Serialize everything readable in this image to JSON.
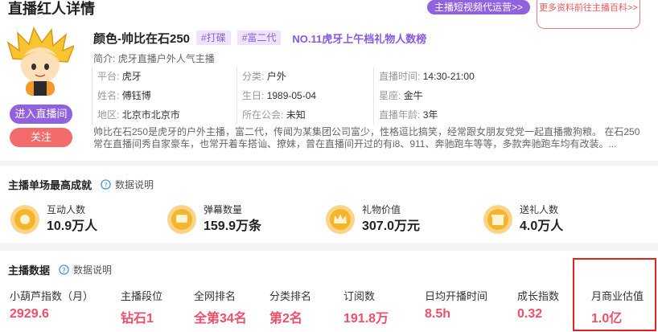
{
  "header": {
    "title": "直播红人详情",
    "promo_button": "主播短视频代运营>>",
    "more_button": "更多资料前往主播百科>>"
  },
  "profile": {
    "name": "颜色-帅比在石250",
    "tags": [
      "#打碟",
      "#富二代"
    ],
    "rank_text": "NO.11虎牙上午档礼物人数榜",
    "intro_label": "简介:",
    "intro": "虎牙直播户外人气主播",
    "enter_live_label": "进入直播间",
    "follow_label": "关注",
    "info": [
      {
        "key": "平台:",
        "value": "虎牙"
      },
      {
        "key": "分类:",
        "value": "户外"
      },
      {
        "key": "直播时间:",
        "value": "14:30-21:00"
      },
      {
        "key": "姓名:",
        "value": "傅钰博"
      },
      {
        "key": "生日:",
        "value": "1989-05-04"
      },
      {
        "key": "星座:",
        "value": "金牛"
      },
      {
        "key": "地区:",
        "value": "北京市北京市"
      },
      {
        "key": "所在公会:",
        "value": "未知"
      },
      {
        "key": "直播年龄:",
        "value": "3年"
      }
    ],
    "description": "帅比在石250是虎牙的户外主播，富二代，传闻为某集团公司富少，性格逗比搞笑，经常跟女朋友党党一起直播撒狗粮。 在石250常在直播间秀自家豪车，也常开着车搭讪、撩妹，曾在直播间开过的有i8、911、奔驰跑车等等，多款奔驰跑车均有改装。..."
  },
  "peak": {
    "title": "主播单场最高成就",
    "help": "数据说明",
    "stats": [
      {
        "label": "互动人数",
        "value": "10.9万人",
        "icon": "interaction-medal-icon"
      },
      {
        "label": "弹幕数量",
        "value": "159.9万条",
        "icon": "danmaku-medal-icon"
      },
      {
        "label": "礼物价值",
        "value": "307.0万元",
        "icon": "gift-crown-medal-icon"
      },
      {
        "label": "送礼人数",
        "value": "4.0万人",
        "icon": "gift-givers-medal-icon"
      }
    ]
  },
  "anchor_data": {
    "title": "主播数据",
    "help": "数据说明",
    "metrics": [
      {
        "label": "小葫芦指数（月）",
        "value": "2929.6"
      },
      {
        "label": "主播段位",
        "value": "钻石1"
      },
      {
        "label": "全网排名",
        "value": "全第34名"
      },
      {
        "label": "分类排名",
        "value": "第2名"
      },
      {
        "label": "订阅数",
        "value": "191.8万"
      },
      {
        "label": "日均开播时间",
        "value": "8.5h"
      },
      {
        "label": "成长指数",
        "value": "0.32"
      },
      {
        "label": "月商业估值",
        "value": "1.0亿"
      }
    ]
  },
  "colors": {
    "purple": "#9162e0",
    "red": "#f36b6b",
    "metric_red": "#ef4f6b",
    "gold": "#f5b52b",
    "highlight_border": "#e0241d"
  }
}
